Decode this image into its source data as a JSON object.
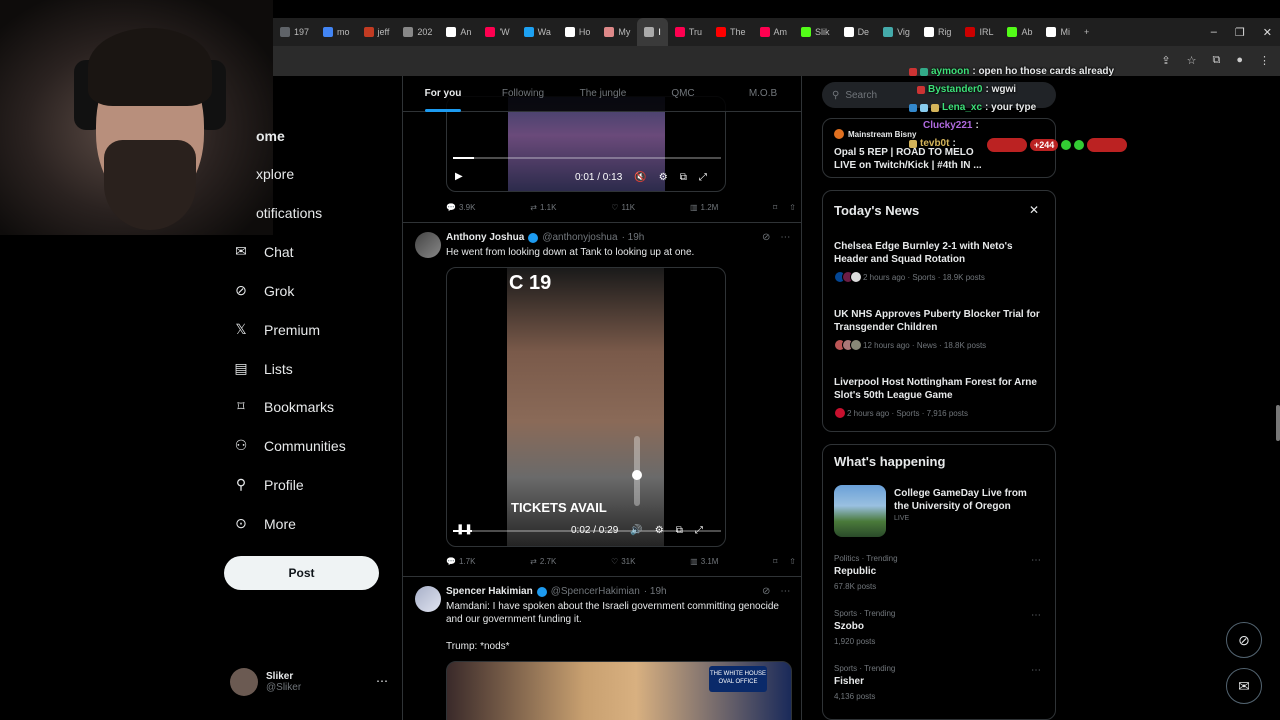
{
  "browser": {
    "tabs": [
      {
        "label": "197",
        "color": "#5f6368"
      },
      {
        "label": "mo",
        "color": "#4285f4"
      },
      {
        "label": "jeff",
        "color": "#c23b22"
      },
      {
        "label": "202",
        "color": "#888888"
      },
      {
        "label": "An",
        "color": "#ffffff"
      },
      {
        "label": "'W",
        "color": "#ff0050"
      },
      {
        "label": "Wa",
        "color": "#1da1f2"
      },
      {
        "label": "Ho",
        "color": "#ffffff"
      },
      {
        "label": "My",
        "color": "#d88"
      },
      {
        "label": "I",
        "color": "#aaa"
      },
      {
        "label": "Tru",
        "color": "#ff0050"
      },
      {
        "label": "The",
        "color": "#ff0000"
      },
      {
        "label": "Am",
        "color": "#ff0050"
      },
      {
        "label": "Slik",
        "color": "#53fc18"
      },
      {
        "label": "De",
        "color": "#ffffff"
      },
      {
        "label": "Vig",
        "color": "#4aa"
      },
      {
        "label": "Rig",
        "color": "#ffffff"
      },
      {
        "label": "IRL",
        "color": "#c00"
      },
      {
        "label": "Ab",
        "color": "#53fc18"
      },
      {
        "label": "Mi",
        "color": "#ffffff"
      }
    ],
    "active_tab_index": 9,
    "new_tab": "+"
  },
  "sidebar": {
    "items": [
      {
        "label": "ome",
        "icon": "home-icon",
        "glyph": ""
      },
      {
        "label": "xplore",
        "icon": "explore-icon",
        "glyph": ""
      },
      {
        "label": "otifications",
        "icon": "bell-icon",
        "glyph": ""
      },
      {
        "label": "Chat",
        "icon": "mail-icon",
        "glyph": "✉"
      },
      {
        "label": "Grok",
        "icon": "grok-icon",
        "glyph": "⊘"
      },
      {
        "label": "Premium",
        "icon": "x-logo-icon",
        "glyph": "𝕏"
      },
      {
        "label": "Lists",
        "icon": "list-icon",
        "glyph": "▤"
      },
      {
        "label": "Bookmarks",
        "icon": "bookmark-icon",
        "glyph": "🔖"
      },
      {
        "label": "Communities",
        "icon": "people-icon",
        "glyph": "👥"
      },
      {
        "label": "Profile",
        "icon": "person-icon",
        "glyph": "👤"
      },
      {
        "label": "More",
        "icon": "more-circle-icon",
        "glyph": "⋯"
      }
    ],
    "post_label": "Post",
    "user": {
      "name": "Sliker",
      "handle": "@Sliker"
    }
  },
  "feed": {
    "tabs": [
      "For you",
      "Following",
      "The jungle",
      "QMC",
      "M.O.B"
    ],
    "active_tab": "For you",
    "tweets": [
      {
        "video_time": "0:01 / 0:13",
        "progress": 0.08,
        "stats": {
          "replies": "3.9K",
          "retweets": "1.1K",
          "likes": "11K",
          "views": "1.2M"
        }
      },
      {
        "name": "Anthony Joshua",
        "handle": "@anthonyjoshua",
        "time": "· 19h",
        "text": "He went from looking down at Tank to looking up at one.",
        "video_time": "0:02 / 0:29",
        "video_caption": "TICKETS AVAIL",
        "video_header": "C 19",
        "progress": 0.07,
        "stats": {
          "replies": "1.7K",
          "retweets": "2.7K",
          "likes": "31K",
          "views": "3.1M"
        }
      },
      {
        "name": "Spencer Hakimian",
        "handle": "@SpencerHakimian",
        "time": "· 19h",
        "text": "Mamdani: I have spoken about the Israeli government committing genocide and our government funding it.",
        "text2": "Trump: *nods*",
        "image_caption": "THE WHITE HOUSE OVAL OFFICE"
      }
    ]
  },
  "right": {
    "search_placeholder": "Search",
    "live": {
      "host": "Mainstream Bisny",
      "title": "Opal 5 REP | ROAD TO MELO LIVE on Twitch/Kick | #4th IN ...",
      "count": "+244"
    },
    "news": {
      "title": "Today's News",
      "items": [
        {
          "title": "Chelsea Edge Burnley 2-1 with Neto's Header and Squad Rotation",
          "meta": "2 hours ago · Sports · 18.9K posts"
        },
        {
          "title": "UK NHS Approves Puberty Blocker Trial for Transgender Children",
          "meta": "12 hours ago · News · 18.8K posts"
        },
        {
          "title": "Liverpool Host Nottingham Forest for Arne Slot's 50th League Game",
          "meta": "2 hours ago · Sports · 7,916 posts"
        }
      ]
    },
    "happening": {
      "title": "What's happening",
      "event": {
        "title": "College GameDay Live from the University of Oregon",
        "status": "LIVE"
      },
      "trends": [
        {
          "category": "Politics · Trending",
          "name": "Republic",
          "count": "67.8K posts"
        },
        {
          "category": "Sports · Trending",
          "name": "Szobo",
          "count": "1,920 posts"
        },
        {
          "category": "Sports · Trending",
          "name": "Fisher",
          "count": "4,136 posts"
        }
      ]
    }
  },
  "chat": {
    "messages": [
      {
        "user": "aymoon",
        "text": ": open ho those cards already",
        "color": "#3ee07a"
      },
      {
        "user": "Bystander0",
        "text": ": wgwi",
        "color": "#3ee07a"
      },
      {
        "user": "Lena_xc",
        "text": ": your type",
        "color": "#3ee07a"
      },
      {
        "user": "Clucky221",
        "text": ":",
        "color": "#b06adf"
      },
      {
        "user": "tevb0t",
        "text": ":",
        "color": "#d4b45a"
      }
    ]
  }
}
